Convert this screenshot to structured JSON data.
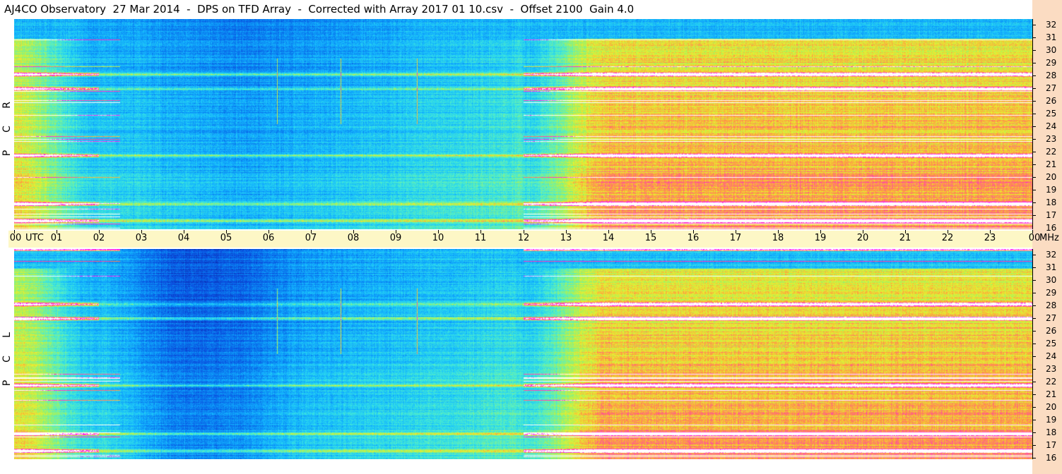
{
  "title": "AJ4CO Observatory  27 Mar 2014  -  DPS on TFD Array  -  Corrected with Array 2017 01 10.csv  -  Offset 2100  Gain 4.0",
  "chart_data": {
    "type": "heatmap",
    "title": "AJ4CO Observatory  27 Mar 2014  -  DPS on TFD Array  -  Corrected with Array 2017 01 10.csv  -  Offset 2100  Gain 4.0",
    "x_axis": {
      "unit": "UTC",
      "ticks": [
        "00",
        "01",
        "02",
        "03",
        "04",
        "05",
        "06",
        "07",
        "08",
        "09",
        "10",
        "11",
        "12",
        "13",
        "14",
        "15",
        "16",
        "17",
        "18",
        "19",
        "20",
        "21",
        "22",
        "23",
        "00"
      ],
      "range_hours": [
        0,
        24
      ]
    },
    "y_axis": {
      "unit": "MHz",
      "ticks": [
        "16",
        "17",
        "18",
        "19",
        "20",
        "21",
        "22",
        "23",
        "24",
        "25",
        "26",
        "27",
        "28",
        "29",
        "30",
        "31",
        "32"
      ],
      "range_mhz": [
        16,
        32
      ]
    },
    "panels": [
      {
        "name": "R C P",
        "letters": [
          "R",
          "C",
          "P"
        ]
      },
      {
        "name": "L C P",
        "letters": [
          "L",
          "C",
          "P"
        ]
      }
    ],
    "colormap": [
      "#0a2fb0",
      "#0a4fe0",
      "#0a7ff0",
      "#12b0ff",
      "#2ad8ee",
      "#5af0c0",
      "#a0f060",
      "#e8f030",
      "#ff9a40",
      "#ff40b0",
      "#ff20ff",
      "#ffffff"
    ],
    "features": {
      "quiet_interval_utc": [
        2,
        12
      ],
      "noisy_interval_utc": [
        12.5,
        24
      ],
      "vertical_spikes_utc": [
        6.2,
        7.7,
        9.5
      ],
      "interference_bands_mhz": [
        16.6,
        17.9,
        21.6,
        26.7,
        27.8
      ]
    }
  }
}
